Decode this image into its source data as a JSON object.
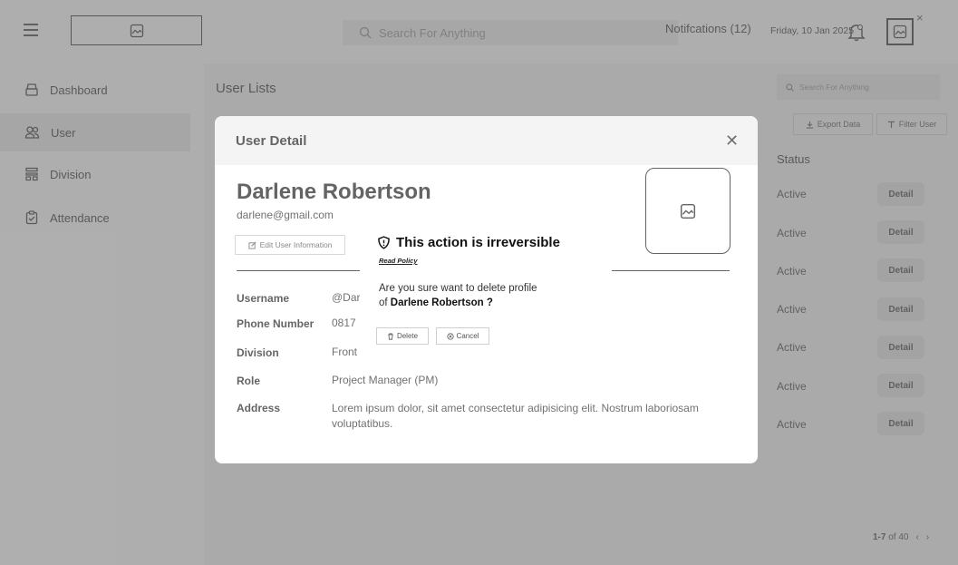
{
  "topbar": {
    "search_placeholder": "Search For Anything",
    "notifications": "Notifcations (12)",
    "date": "Friday, 10 Jan 2025"
  },
  "sidebar": {
    "items": [
      {
        "label": "Dashboard",
        "icon": "dashboard-icon"
      },
      {
        "label": "User",
        "icon": "users-icon"
      },
      {
        "label": "Division",
        "icon": "division-icon"
      },
      {
        "label": "Attendance",
        "icon": "attendance-icon"
      }
    ],
    "active": "User"
  },
  "main": {
    "title": "User Lists",
    "search_placeholder": "Search For Anything",
    "export_label": "Export Data",
    "filter_label": "Filter User",
    "status_header": "Status",
    "rows": [
      {
        "status": "Active",
        "action": "Detail"
      },
      {
        "status": "Active",
        "action": "Detail"
      },
      {
        "status": "Active",
        "action": "Detail"
      },
      {
        "status": "Active",
        "action": "Detail"
      },
      {
        "status": "Active",
        "action": "Detail"
      },
      {
        "status": "Active",
        "action": "Detail"
      },
      {
        "status": "Active",
        "action": "Detail"
      }
    ],
    "pagination": {
      "range": "1-7",
      "of_label": "of 40"
    }
  },
  "modal": {
    "title": "User Detail",
    "name": "Darlene Robertson",
    "email": "darlene@gmail.com",
    "edit_label": "Edit User Information",
    "fields": [
      {
        "label": "Username",
        "value": "@Dar"
      },
      {
        "label": "Phone Number",
        "value": "0817"
      },
      {
        "label": "Division",
        "value": "Front"
      },
      {
        "label": "Role",
        "value": "Project Manager (PM)"
      },
      {
        "label": "Address",
        "value": "Lorem ipsum dolor, sit amet consectetur adipisicing elit. Nostrum  laboriosam voluptatibus."
      }
    ]
  },
  "confirm": {
    "title": "This action is irreversible",
    "policy": "Read Policy",
    "message_line1": "Are you sure want to delete profile",
    "message_prefix": "of",
    "message_name": "Darlene Robertson ?",
    "delete_label": "Delete",
    "cancel_label": "Cancel"
  }
}
